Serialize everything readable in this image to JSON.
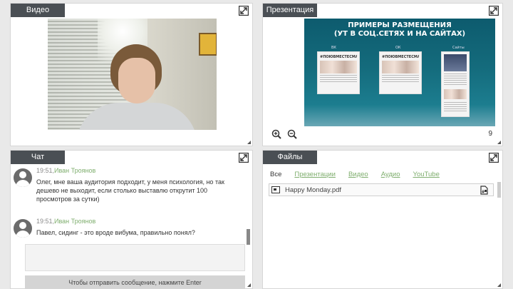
{
  "video": {
    "tab_label": "Видео"
  },
  "presentation": {
    "tab_label": "Презентация",
    "slide": {
      "title_line1": "ПРИМЕРЫ РАЗМЕЩЕНИЯ",
      "title_line2": "(УТ В СОЦ.СЕТЯХ И НА САЙТАХ)",
      "columns": [
        "ВК",
        "ОК",
        "Сайты"
      ],
      "card_banner": "#ПОЮВМЕСТЕСМАС"
    },
    "page_number": "9"
  },
  "chat": {
    "tab_label": "Чат",
    "messages": [
      {
        "time": "19:51,",
        "author": "Иван Троянов",
        "text": "Олег, мне ваша аудитория подходит, у меня психология, но так дешево не выходит, если столько выставлю открутит 100 просмотров за сутки)"
      },
      {
        "time": "19:51,",
        "author": "Иван Троянов",
        "text": "Павел, сидинг - это вроде вибума, правильно понял?"
      }
    ],
    "send_hint": "Чтобы отправить сообщение, нажмите Enter"
  },
  "files": {
    "tab_label": "Файлы",
    "tabs": [
      "Все",
      "Презентации",
      "Видео",
      "Аудио",
      "YouTube"
    ],
    "items": [
      {
        "name": "Happy Monday.pdf"
      }
    ]
  },
  "colors": {
    "tab_bg": "#4a4f54",
    "author_green": "#7fae6e",
    "link_green": "#7fae6e"
  }
}
